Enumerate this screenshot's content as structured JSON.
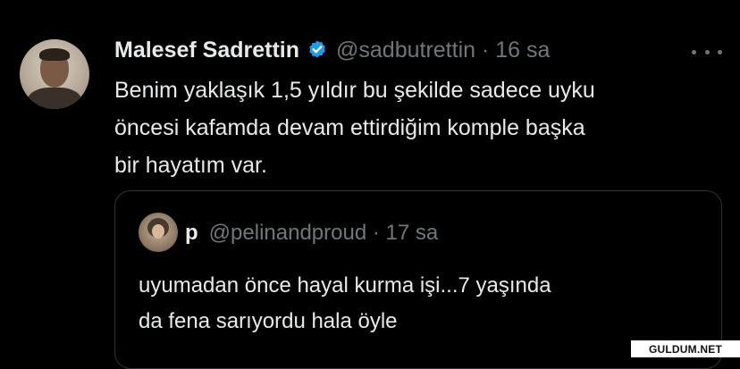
{
  "tweet": {
    "display_name": "Malesef Sadrettin",
    "handle_time": "@sadbutrettin · 16 sa",
    "text_lines": [
      "Benim yaklaşık 1,5 yıldır bu şekilde sadece uyku",
      "öncesi kafamda devam ettirdiğim komple başka",
      "bir hayatım var."
    ]
  },
  "quoted_tweet": {
    "display_name": "p",
    "handle_time": "@pelinandproud · 17 sa",
    "text_lines": [
      "uyumadan önce hayal kurma işi...7 yaşında",
      "da fena sarıyordu hala öyle"
    ]
  },
  "watermark": {
    "text": "GULDUM.NET"
  },
  "colors": {
    "background": "#000000",
    "text": "#e7e9ea",
    "secondary": "#71767b",
    "border": "#2f3336",
    "verified_blue": "#1d9bf0"
  },
  "icons": {
    "verified": "verified-badge-icon",
    "more": "more-options-icon"
  }
}
